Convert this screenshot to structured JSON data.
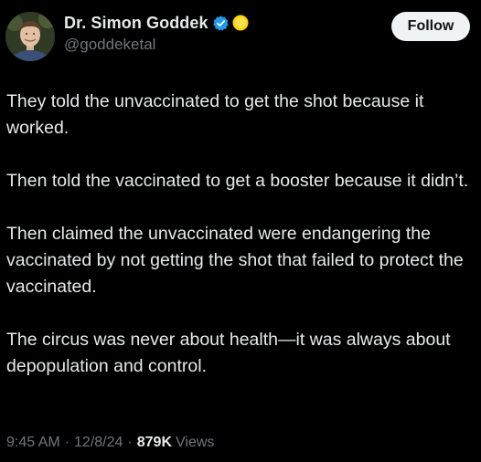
{
  "author": {
    "display_name": "Dr. Simon Goddek",
    "handle": "@goddeketal",
    "verified_icon": "verified-badge-icon",
    "badge_icon": "yellow-coin-icon",
    "avatar_icon": "profile-avatar"
  },
  "actions": {
    "follow_label": "Follow"
  },
  "tweet": {
    "paragraphs": [
      "They told the unvaccinated to get the shot because it worked.",
      "Then told the vaccinated to get a booster because it didn’t.",
      "Then claimed the unvaccinated were endangering the vaccinated by not getting the shot that failed to protect the vaccinated.",
      "The circus was never about health—it was always about depopulation and control."
    ]
  },
  "meta": {
    "time": "9:45 AM",
    "separator": "·",
    "date": "12/8/24",
    "views_count": "879K",
    "views_label": "Views"
  },
  "colors": {
    "background": "#000000",
    "text": "#e7e9ea",
    "secondary_text": "#71767b",
    "verified_blue": "#1d9bf0",
    "badge_yellow": "#ffd400",
    "follow_bg": "#eff3f4"
  }
}
